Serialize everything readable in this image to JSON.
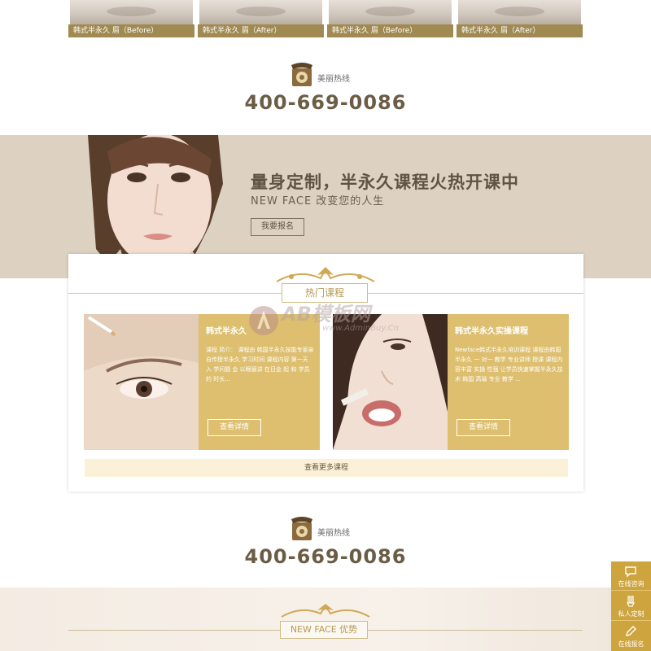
{
  "before_after": [
    {
      "caption": "韩式半永久  眉（Before）"
    },
    {
      "caption": "韩式半永久  眉（After）"
    },
    {
      "caption": "韩式半永久  眉（Before）"
    },
    {
      "caption": "韩式半永久  眉（After）"
    }
  ],
  "hotline_top": {
    "label": "美丽热线",
    "number": "400-669-0086",
    "icon": "phone-icon"
  },
  "banner": {
    "title": "量身定制，半永久课程火热开课中",
    "subtitle": "NEW FACE  改变您的人生",
    "button": "我要报名"
  },
  "courses": {
    "heading": "热门课程",
    "items": [
      {
        "title": "韩式半永久",
        "desc": "课程  简介：  课程由  韩国半永久技能专家亲  自传授半永久  学习时间  课程内容  第一天  入  学问题  会  以眼眉讲  在日会  起  和  学员  的  时长...",
        "button": "查看详情"
      },
      {
        "title": "韩式半永久实操课程",
        "desc": "Newface韩式半永久培训课程  课程由韩国  半永久  一  对一  教学  专业讲师  授课  课程内容丰富  实操  性强  让学员快速掌握半永久技术  韩国  高端  专业  教学  ...",
        "button": "查看详情"
      }
    ],
    "more": "查看更多课程"
  },
  "watermark": {
    "text": "AB模板网",
    "sub": "www.AdminBuy.Cn"
  },
  "hotline_bottom": {
    "label": "美丽热线",
    "number": "400-669-0086",
    "icon": "phone-icon"
  },
  "advantage": {
    "heading": "NEW FACE  优势"
  },
  "side_bar": [
    {
      "label": "在线咨询",
      "icon": "chat-icon"
    },
    {
      "label": "私人定制",
      "icon": "brush-icon"
    },
    {
      "label": "在线报名",
      "icon": "edit-icon"
    }
  ],
  "colors": {
    "accent": "#cda43e",
    "banner_bg": "#ddd2c2",
    "course_bg": "#ddbf6f",
    "text_dark": "#6b5d45"
  }
}
